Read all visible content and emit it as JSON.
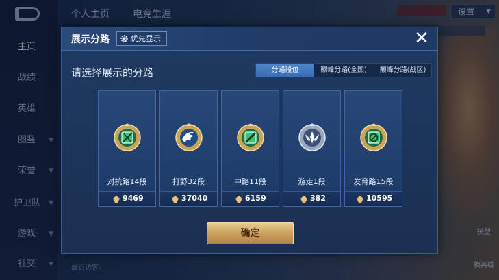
{
  "background": {
    "top_nav": [
      "个人主页",
      "电竞生涯"
    ],
    "settings_label": "设置",
    "sidebar": [
      {
        "label": "主页",
        "active": true
      },
      {
        "label": "战绩"
      },
      {
        "label": "英雄"
      },
      {
        "label": "图鉴",
        "arrow": true
      },
      {
        "label": "荣誉",
        "arrow": true
      },
      {
        "label": "护卫队",
        "arrow": true
      },
      {
        "label": "游戏",
        "arrow": true
      },
      {
        "label": "社交",
        "arrow": true
      }
    ],
    "right_buttons": [
      "模型",
      "换英雄"
    ],
    "visitor_label": "最近访客:"
  },
  "modal": {
    "title": "展示分路",
    "priority_label": "优先显示",
    "close_label": "✕",
    "prompt": "请选择展示的分路",
    "tabs": [
      {
        "label": "分路段位",
        "active": true
      },
      {
        "label": "巅峰分路(全国)"
      },
      {
        "label": "巅峰分路(战区)"
      }
    ],
    "lanes": [
      {
        "name": "对抗路14段",
        "score": "9469",
        "icon": "clash-lane-icon",
        "color": "#3fbf7a"
      },
      {
        "name": "打野32段",
        "score": "37040",
        "icon": "jungle-icon",
        "color": "#3b8de0"
      },
      {
        "name": "中路11段",
        "score": "6159",
        "icon": "mid-lane-icon",
        "color": "#3fbf7a"
      },
      {
        "name": "游走1段",
        "score": "382",
        "icon": "roam-icon",
        "color": "#7c8fb0"
      },
      {
        "name": "发育路15段",
        "score": "10595",
        "icon": "farm-lane-icon",
        "color": "#3fbf7a"
      }
    ],
    "confirm_label": "确定"
  },
  "colors": {
    "modal_bg": "#1f3a64",
    "tab_active": "#3a6cb0",
    "confirm_gold": "#c99e5c"
  }
}
